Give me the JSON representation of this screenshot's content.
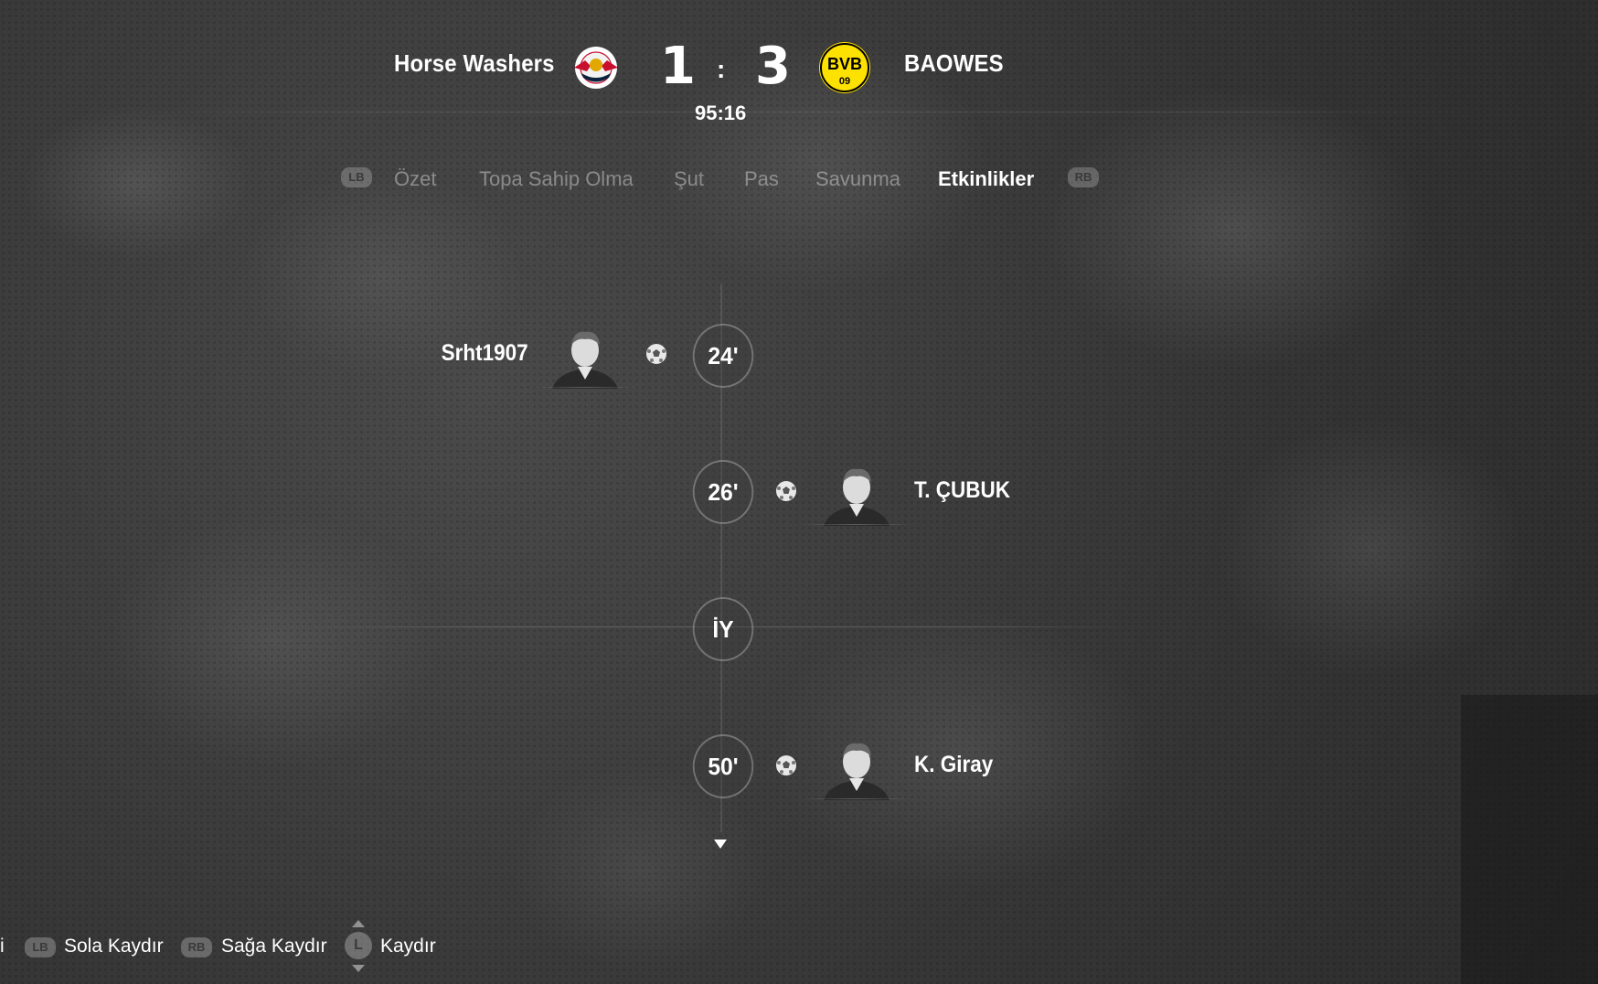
{
  "match": {
    "home_team": "Horse Washers",
    "away_team": "BAOWES",
    "home_score": "1",
    "away_score": "3",
    "separator": ":",
    "clock": "95:16",
    "home_crest_icon": "rb-leipzig-crest-icon",
    "away_crest_icon": "bvb-crest-icon",
    "away_crest_text_top": "BVB",
    "away_crest_text_bottom": "09"
  },
  "tabs": {
    "left_bumper": "LB",
    "right_bumper": "RB",
    "items": [
      {
        "label": "Özet",
        "active": false
      },
      {
        "label": "Topa Sahip Olma",
        "active": false
      },
      {
        "label": "Şut",
        "active": false
      },
      {
        "label": "Pas",
        "active": false
      },
      {
        "label": "Savunma",
        "active": false
      },
      {
        "label": "Etkinlikler",
        "active": true
      }
    ]
  },
  "events": [
    {
      "minute": "24'",
      "side": "home",
      "player": "Srht1907",
      "type": "goal"
    },
    {
      "minute": "26'",
      "side": "away",
      "player": "T. ÇUBUK",
      "type": "goal"
    },
    {
      "minute": "İY",
      "side": "center",
      "player": "",
      "type": "half-time"
    },
    {
      "minute": "50'",
      "side": "away",
      "player": "K. Giray",
      "type": "goal"
    }
  ],
  "footer": {
    "cut_text": "i",
    "lb_label": "LB",
    "lb_text": "Sola Kaydır",
    "rb_label": "RB",
    "rb_text": "Sağa Kaydır",
    "stick_label": "L",
    "stick_text": "Kaydır"
  }
}
